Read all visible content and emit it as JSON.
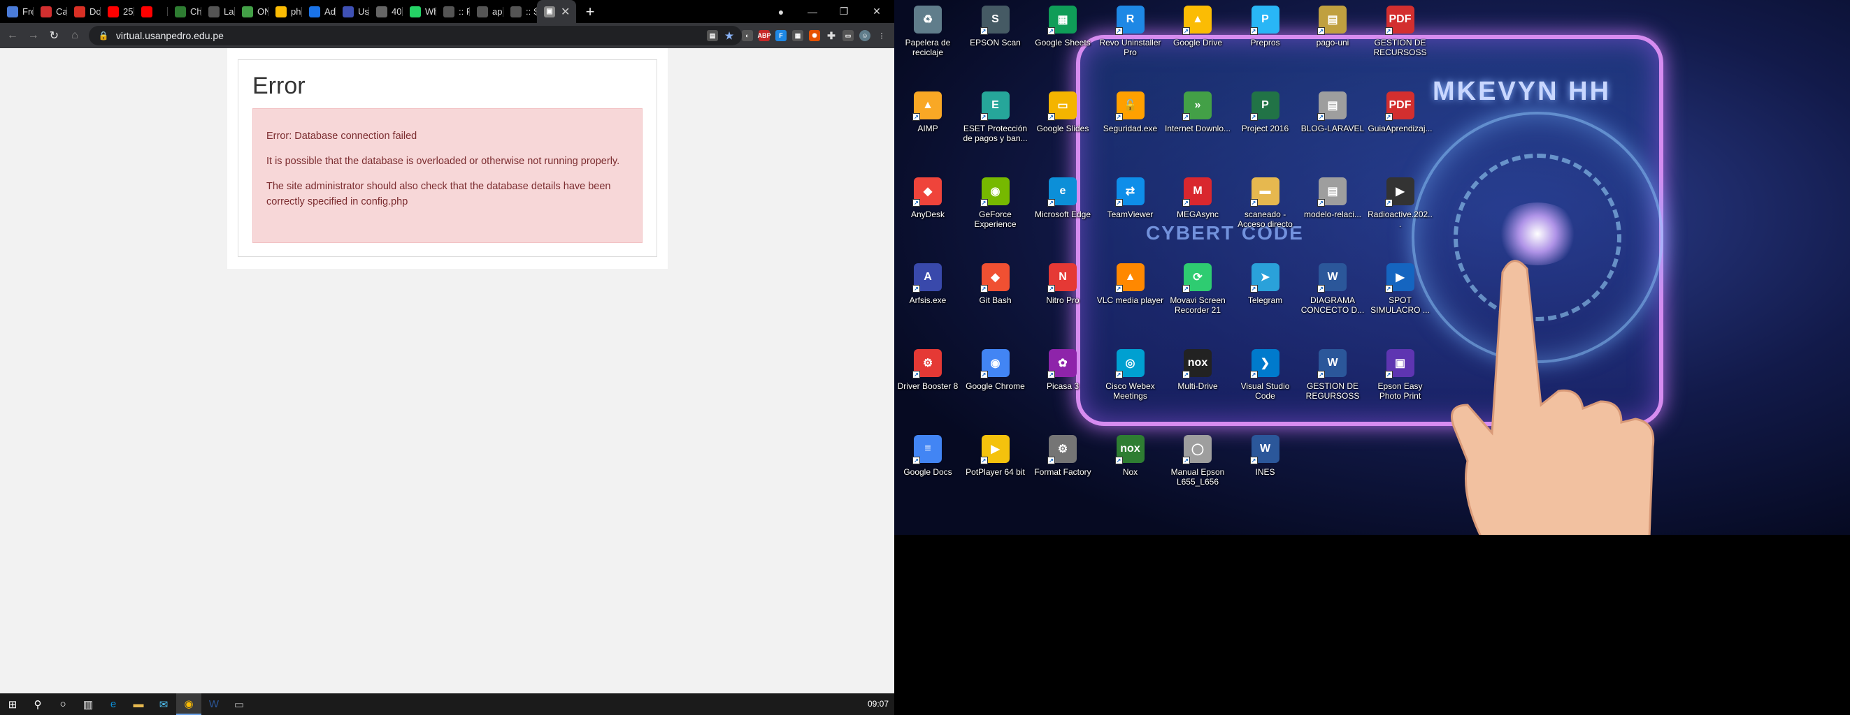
{
  "browser": {
    "tabs": [
      {
        "label": "Fre",
        "icon": "doc-icon",
        "color": "#4a7bd8"
      },
      {
        "label": "Car",
        "icon": "acrobat-icon",
        "color": "#d32f2f"
      },
      {
        "label": "Do",
        "icon": "gmail-icon",
        "color": "#d93025"
      },
      {
        "label": "25",
        "icon": "youtube-icon",
        "color": "#ff0000"
      },
      {
        "label": "",
        "icon": "youtube-icon",
        "color": "#ff0000"
      },
      {
        "label": "Che",
        "icon": "leaf-icon",
        "color": "#2e7d32"
      },
      {
        "label": "Lar",
        "icon": "laravel-icon",
        "color": "#555555"
      },
      {
        "label": "ON",
        "icon": "on-icon",
        "color": "#43a047"
      },
      {
        "label": "php",
        "icon": "drive-icon",
        "color": "#fbbc04"
      },
      {
        "label": "Adr",
        "icon": "at-icon",
        "color": "#1a73e8"
      },
      {
        "label": "Usc",
        "icon": "flag-icon",
        "color": "#3f51b5"
      },
      {
        "label": "40",
        "icon": "bitcoin-icon",
        "color": "#666666"
      },
      {
        "label": "Wh",
        "icon": "whatsapp-icon",
        "color": "#25d366"
      },
      {
        "label": ":: P",
        "icon": "globe-icon",
        "color": "#555555"
      },
      {
        "label": "app",
        "icon": "globe-icon",
        "color": "#555555"
      },
      {
        "label": ":: S",
        "icon": "globe-icon",
        "color": "#555555"
      }
    ],
    "active_tab_icon": "moodle-icon",
    "url": "virtual.usanpedro.edu.pe"
  },
  "error_page": {
    "title": "Error",
    "line1": "Error: Database connection failed",
    "line2": "It is possible that the database is overloaded or otherwise not running properly.",
    "line3": "The site administrator should also check that the database details have been correctly specified in config.php"
  },
  "taskbar": {
    "clock": "09:07"
  },
  "wallpaper": {
    "title": "MKEVYN HH",
    "subtitle": "CYBERT CODE"
  },
  "desktop_icons": [
    {
      "label": "Papelera de reciclaje",
      "icon": "recycle-bin-icon",
      "color": "#607d8b",
      "glyph": "♻"
    },
    {
      "label": "EPSON Scan",
      "icon": "scanner-icon",
      "color": "#455a64",
      "glyph": "S"
    },
    {
      "label": "Google Sheets",
      "icon": "sheets-icon",
      "color": "#0f9d58",
      "glyph": "▦"
    },
    {
      "label": "Revo Uninstaller Pro",
      "icon": "revo-icon",
      "color": "#1e88e5",
      "glyph": "R"
    },
    {
      "label": "Google Drive",
      "icon": "drive-icon",
      "color": "#fbbc04",
      "glyph": "▲"
    },
    {
      "label": "Prepros",
      "icon": "prepros-icon",
      "color": "#29b6f6",
      "glyph": "P"
    },
    {
      "label": "pago-uni",
      "icon": "archive-icon",
      "color": "#c0a040",
      "glyph": "▤"
    },
    {
      "label": "GESTION DE RECURSOSS",
      "icon": "pdf-icon",
      "color": "#d32f2f",
      "glyph": "PDF"
    },
    {
      "label": "AIMP",
      "icon": "aimp-icon",
      "color": "#f9a825",
      "glyph": "▲"
    },
    {
      "label": "ESET Protección de pagos y ban...",
      "icon": "eset-icon",
      "color": "#26a69a",
      "glyph": "E"
    },
    {
      "label": "Google Slides",
      "icon": "slides-icon",
      "color": "#f4b400",
      "glyph": "▭"
    },
    {
      "label": "Seguridad.exe",
      "icon": "lock-icon",
      "color": "#ffa000",
      "glyph": "🔓"
    },
    {
      "label": "Internet Downlo...",
      "icon": "idm-icon",
      "color": "#43a047",
      "glyph": "»"
    },
    {
      "label": "Project 2016",
      "icon": "project-icon",
      "color": "#217346",
      "glyph": "P"
    },
    {
      "label": "BLOG-LARAVEL",
      "icon": "image-file-icon",
      "color": "#9e9e9e",
      "glyph": "▤"
    },
    {
      "label": "GuiaAprendizaj...",
      "icon": "pdf-icon",
      "color": "#d32f2f",
      "glyph": "PDF"
    },
    {
      "label": "AnyDesk",
      "icon": "anydesk-icon",
      "color": "#ef443b",
      "glyph": "◆"
    },
    {
      "label": "GeForce Experience",
      "icon": "nvidia-icon",
      "color": "#76b900",
      "glyph": "◉"
    },
    {
      "label": "Microsoft Edge",
      "icon": "edge-icon",
      "color": "#0c8fd8",
      "glyph": "e"
    },
    {
      "label": "TeamViewer",
      "icon": "teamviewer-icon",
      "color": "#0e8ee9",
      "glyph": "⇄"
    },
    {
      "label": "MEGAsync",
      "icon": "mega-icon",
      "color": "#d9272e",
      "glyph": "M"
    },
    {
      "label": "scaneado - Acceso directo",
      "icon": "folder-icon",
      "color": "#e6b84f",
      "glyph": "▬"
    },
    {
      "label": "modelo-relaci...",
      "icon": "image-file-icon",
      "color": "#9e9e9e",
      "glyph": "▤"
    },
    {
      "label": "Radioactive.202...",
      "icon": "video-file-icon",
      "color": "#333333",
      "glyph": "▶"
    },
    {
      "label": "Arfsis.exe",
      "icon": "arfsis-icon",
      "color": "#3949ab",
      "glyph": "A"
    },
    {
      "label": "Git Bash",
      "icon": "git-icon",
      "color": "#f05032",
      "glyph": "◆"
    },
    {
      "label": "Nitro Pro",
      "icon": "nitro-icon",
      "color": "#e53935",
      "glyph": "N"
    },
    {
      "label": "VLC media player",
      "icon": "vlc-icon",
      "color": "#ff8800",
      "glyph": "▲"
    },
    {
      "label": "Movavi Screen Recorder 21",
      "icon": "movavi-icon",
      "color": "#2ecc71",
      "glyph": "⟳"
    },
    {
      "label": "Telegram",
      "icon": "telegram-icon",
      "color": "#2aa1da",
      "glyph": "➤"
    },
    {
      "label": "DIAGRAMA CONCECTO D...",
      "icon": "word-icon",
      "color": "#2b579a",
      "glyph": "W"
    },
    {
      "label": "SPOT SIMULACRO ...",
      "icon": "video-file-icon",
      "color": "#1565c0",
      "glyph": "▶"
    },
    {
      "label": "Driver Booster 8",
      "icon": "driver-booster-icon",
      "color": "#e53935",
      "glyph": "⚙"
    },
    {
      "label": "Google Chrome",
      "icon": "chrome-icon",
      "color": "#4285f4",
      "glyph": "◉"
    },
    {
      "label": "Picasa 3",
      "icon": "picasa-icon",
      "color": "#8e24aa",
      "glyph": "✿"
    },
    {
      "label": "Cisco Webex Meetings",
      "icon": "webex-icon",
      "color": "#00a0d1",
      "glyph": "◎"
    },
    {
      "label": "Multi-Drive",
      "icon": "nox-multi-icon",
      "color": "#222222",
      "glyph": "nox"
    },
    {
      "label": "Visual Studio Code",
      "icon": "vscode-icon",
      "color": "#007acc",
      "glyph": "❯"
    },
    {
      "label": "GESTION DE REGURSOSS",
      "icon": "word-icon",
      "color": "#2b579a",
      "glyph": "W"
    },
    {
      "label": "Epson Easy Photo Print",
      "icon": "epson-photo-icon",
      "color": "#5e35b1",
      "glyph": "▣"
    },
    {
      "label": "Google Docs",
      "icon": "docs-icon",
      "color": "#4285f4",
      "glyph": "≡"
    },
    {
      "label": "PotPlayer 64 bit",
      "icon": "potplayer-icon",
      "color": "#f4c20d",
      "glyph": "▶"
    },
    {
      "label": "Format Factory",
      "icon": "format-factory-icon",
      "color": "#757575",
      "glyph": "⚙"
    },
    {
      "label": "Nox",
      "icon": "nox-icon",
      "color": "#2e7d32",
      "glyph": "nox"
    },
    {
      "label": "Manual Epson L655_L656",
      "icon": "disc-icon",
      "color": "#9e9e9e",
      "glyph": "◯"
    },
    {
      "label": "INES",
      "icon": "word-icon",
      "color": "#2b579a",
      "glyph": "W"
    }
  ]
}
